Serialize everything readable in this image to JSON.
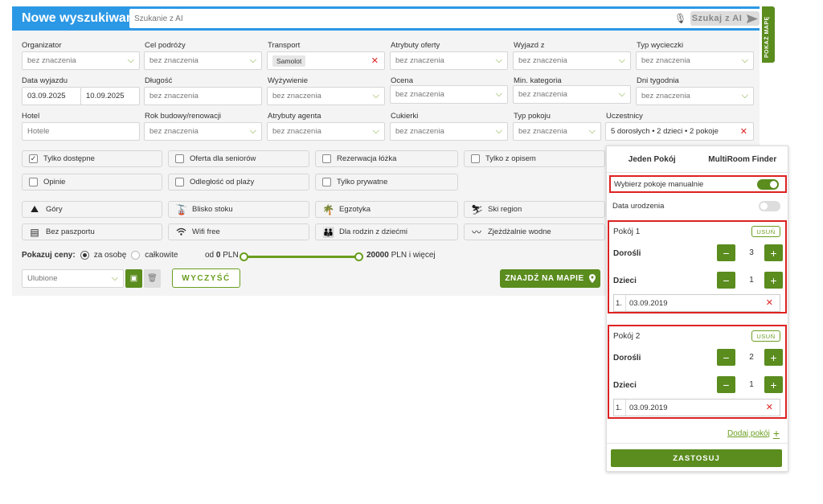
{
  "header": {
    "title": "Nowe wyszukiwanie",
    "search_placeholder": "Szukanie z AI",
    "ai_button": "Szukaj z AI",
    "map_strip": "POKAŻ MAPĘ"
  },
  "filters": {
    "row1": [
      {
        "label": "Organizator",
        "value": "bez znaczenia"
      },
      {
        "label": "Cel podróży",
        "value": "bez znaczenia"
      },
      {
        "label": "Transport",
        "value": "Samolot"
      },
      {
        "label": "Atrybuty oferty",
        "value": "bez znaczenia"
      },
      {
        "label": "Wyjazd z",
        "value": "bez znaczenia"
      },
      {
        "label": "Typ wycieczki",
        "value": "bez znaczenia"
      }
    ],
    "row2": {
      "departure_label": "Data wyjazdu",
      "date_from": "03.09.2025",
      "date_to": "10.09.2025",
      "length_label": "Długość",
      "length_value": "bez znaczenia",
      "board_label": "Wyżywienie",
      "board_value": "bez znaczenia",
      "rating_label": "Ocena",
      "rating_value": "bez znaczenia",
      "category_label": "Min. kategoria",
      "category_value": "bez znaczenia",
      "days_label": "Dni tygodnia",
      "days_value": "bez znaczenia"
    },
    "row3": {
      "hotel_label": "Hotel",
      "hotel_placeholder": "Hotele",
      "year_label": "Rok budowy/renowacji",
      "year_value": "bez znaczenia",
      "agent_label": "Atrybuty agenta",
      "agent_value": "bez znaczenia",
      "treats_label": "Cukierki",
      "treats_value": "bez znaczenia",
      "room_type_label": "Typ pokoju",
      "room_type_value": "bez znaczenia",
      "participants_label": "Uczestnicy",
      "participants_value": "5 dorosłych • 2 dzieci • 2 pokoje"
    }
  },
  "options": {
    "checkboxes": [
      {
        "label": "Tylko dostępne",
        "checked": true
      },
      {
        "label": "Oferta dla seniorów",
        "checked": false
      },
      {
        "label": "Rezerwacja łóżka",
        "checked": false
      },
      {
        "label": "Tylko z opisem",
        "checked": false
      },
      {
        "label": "Opinie",
        "checked": false
      },
      {
        "label": "Odległość od plaży",
        "checked": false
      },
      {
        "label": "Tylko prywatne",
        "checked": false
      }
    ],
    "attributes": [
      {
        "label": "Góry",
        "icon": "mountain-icon"
      },
      {
        "label": "Blisko stoku",
        "icon": "ski-lift-icon"
      },
      {
        "label": "Egzotyka",
        "icon": "palm-icon"
      },
      {
        "label": "Ski region",
        "icon": "skier-icon"
      },
      {
        "label": "Bez paszportu",
        "icon": "passport-icon"
      },
      {
        "label": "Wifi free",
        "icon": "wifi-icon"
      },
      {
        "label": "Dla rodzin z dziećmi",
        "icon": "family-icon"
      },
      {
        "label": "Zjeżdżalnie wodne",
        "icon": "waterslide-icon"
      }
    ]
  },
  "prices": {
    "label": "Pokazuj ceny:",
    "per_person": "za osobę",
    "total": "całkowite",
    "from_prefix": "od",
    "from_value": "0",
    "to_value": "20000",
    "currency": "PLN",
    "to_suffix": "PLN i więcej"
  },
  "actions": {
    "favorites_value": "Ulubione",
    "clear": "WYCZYŚĆ",
    "find_on_map": "ZNAJDŹ NA MAPIE"
  },
  "popup": {
    "tab_single": "Jeden Pokój",
    "tab_multi": "MultiRoom Finder",
    "manual_label": "Wybierz pokoje manualnie",
    "manual_on": true,
    "birthdate_label": "Data urodzenia",
    "birthdate_on": false,
    "remove_label": "USUŃ",
    "adults_label": "Dorośli",
    "children_label": "Dzieci",
    "rooms": [
      {
        "title": "Pokój 1",
        "adults": "3",
        "children": "1",
        "child_index": "1.",
        "child_birth": "03.09.2019"
      },
      {
        "title": "Pokój 2",
        "adults": "2",
        "children": "1",
        "child_index": "1.",
        "child_birth": "03.09.2019"
      }
    ],
    "add_room": "Dodaj pokój",
    "apply": "ZASTOSUJ"
  },
  "colors": {
    "header_blue": "#2b98e5",
    "accent_green": "#5a8c1e",
    "danger_red": "#dd2222"
  }
}
